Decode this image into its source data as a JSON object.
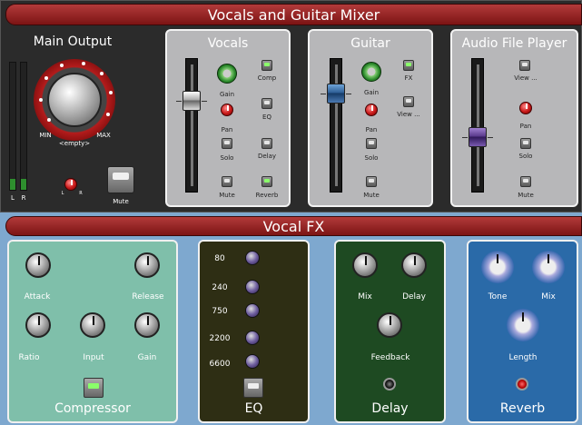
{
  "mixer_title": "Vocals and Guitar Mixer",
  "main_output": {
    "title": "Main Output",
    "knob_value_label": "<empty>",
    "min_label": "MIN",
    "max_label": "MAX",
    "meter_left_label": "L",
    "meter_right_label": "R",
    "balance_left": "L",
    "balance_right": "R",
    "mute_label": "Mute"
  },
  "vocals": {
    "title": "Vocals",
    "gain_label": "Gain",
    "pan_label": "Pan",
    "solo_label": "Solo",
    "mute_label": "Mute",
    "comp_label": "Comp",
    "eq_label": "EQ",
    "delay_label": "Delay",
    "reverb_label": "Reverb"
  },
  "guitar": {
    "title": "Guitar",
    "gain_label": "Gain",
    "pan_label": "Pan",
    "solo_label": "Solo",
    "mute_label": "Mute",
    "fx_label": "FX",
    "view_label": "View ..."
  },
  "audio_file_player": {
    "title": "Audio File Player",
    "view_label": "View ...",
    "pan_label": "Pan",
    "solo_label": "Solo",
    "mute_label": "Mute"
  },
  "fx_title": "Vocal FX",
  "compressor": {
    "title": "Compressor",
    "attack": "Attack",
    "release": "Release",
    "ratio": "Ratio",
    "input": "Input",
    "gain": "Gain"
  },
  "eq": {
    "title": "EQ",
    "bands": [
      "80",
      "240",
      "750",
      "2200",
      "6600"
    ]
  },
  "delay": {
    "title": "Delay",
    "mix": "Mix",
    "delay": "Delay",
    "feedback": "Feedback"
  },
  "reverb": {
    "title": "Reverb",
    "tone": "Tone",
    "mix": "Mix",
    "length": "Length"
  },
  "colors": {
    "title_bar": "#9a2424",
    "channel_panel": "#b7b7b9",
    "compressor_panel": "#7fbfaa",
    "eq_panel": "#2e2e14",
    "delay_panel": "#1e4a22",
    "reverb_panel": "#2a6aa8"
  }
}
